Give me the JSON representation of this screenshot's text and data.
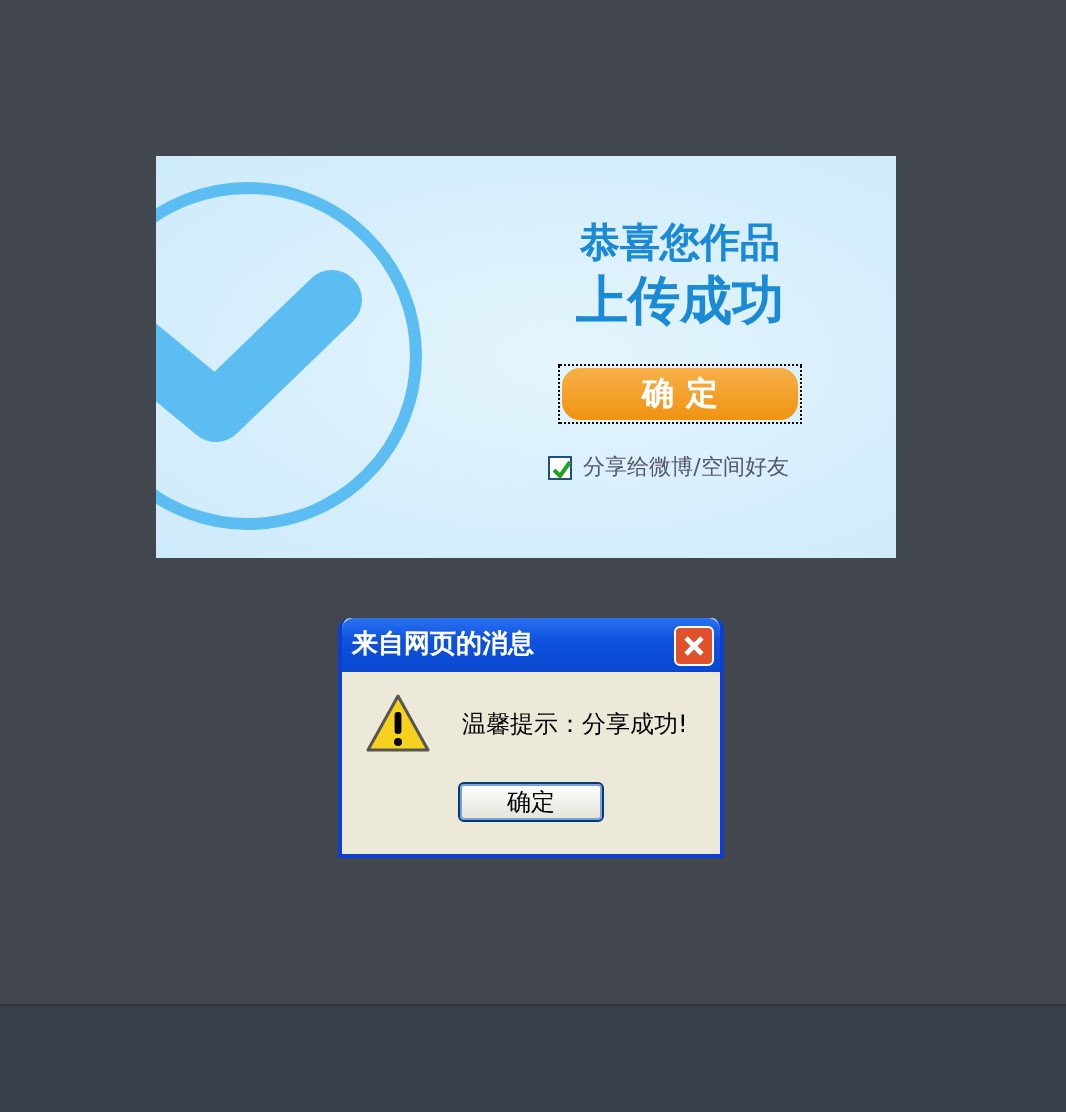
{
  "card": {
    "title_line1": "恭喜您作品",
    "title_line2": "上传成功",
    "button": "确 定",
    "share": {
      "label": "分享给微博/空间好友",
      "checked": true
    }
  },
  "dialog": {
    "title": "来自网页的消息",
    "message": "温馨提示：分享成功!",
    "button": "确定"
  }
}
